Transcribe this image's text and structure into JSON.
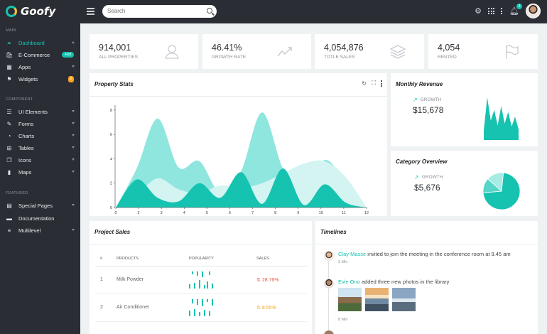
{
  "app": {
    "name": "Goofy"
  },
  "search": {
    "placeholder": "Search"
  },
  "header": {
    "notification_count": "3"
  },
  "sidebar": {
    "sections": [
      {
        "title": "MAIN",
        "items": [
          {
            "label": "Dashboard",
            "icon": "dashboard-icon",
            "active": true
          },
          {
            "label": "E-Commerce",
            "icon": "shop-icon",
            "badge": "Hot"
          },
          {
            "label": "Apps",
            "icon": "apps-grid-icon"
          },
          {
            "label": "Widgets",
            "icon": "flag-icon",
            "badge": "2"
          }
        ]
      },
      {
        "title": "COMPONENT",
        "items": [
          {
            "label": "UI Elements",
            "icon": "list-icon"
          },
          {
            "label": "Forms",
            "icon": "pencil-icon"
          },
          {
            "label": "Charts",
            "icon": "pie-icon"
          },
          {
            "label": "Tables",
            "icon": "table-icon"
          },
          {
            "label": "Icons",
            "icon": "copy-icon"
          },
          {
            "label": "Maps",
            "icon": "map-icon"
          }
        ]
      },
      {
        "title": "FEATURED",
        "items": [
          {
            "label": "Special Pages",
            "icon": "pages-icon"
          },
          {
            "label": "Documentation",
            "icon": "doc-icon"
          },
          {
            "label": "Multilevel",
            "icon": "multilevel-icon"
          }
        ]
      }
    ]
  },
  "stats": [
    {
      "value": "914,001",
      "label": "ALL PROPERTIES",
      "icon": "user-icon"
    },
    {
      "value": "46.41%",
      "label": "GROWTH RATE",
      "icon": "trend-icon"
    },
    {
      "value": "4,054,876",
      "label": "TOTLE SALES",
      "icon": "layers-icon"
    },
    {
      "value": "4,054",
      "label": "RENTED",
      "icon": "flag-icon"
    }
  ],
  "property_stats": {
    "title": "Property Stats"
  },
  "monthly_revenue": {
    "title": "Monthly Revenue",
    "growth_label": "GROWTH",
    "value": "$15,678",
    "sparkline": [
      20,
      88,
      40,
      62,
      30,
      70,
      34,
      58,
      28,
      48,
      22
    ]
  },
  "category_overview": {
    "title": "Category Overview",
    "growth_label": "GROWTH",
    "value": "$5,676",
    "pie": [
      72,
      13,
      15
    ]
  },
  "project_sales": {
    "title": "Project Sales",
    "columns": [
      "#",
      "PRODUCTS",
      "POPULARITY",
      "SALES"
    ],
    "rows": [
      {
        "num": "1",
        "product": "Milk Powder",
        "sales": "28.76%",
        "trend": "up",
        "bars": [
          6,
          -4,
          8,
          -6,
          12,
          -8,
          5,
          10,
          -5,
          7
        ]
      },
      {
        "num": "2",
        "product": "Air Conditioner",
        "sales": "8.55%",
        "trend": "mid",
        "bars": [
          8,
          -6,
          10,
          -8,
          6,
          -10,
          9,
          -4,
          7,
          -9
        ]
      }
    ]
  },
  "timelines": {
    "title": "Timelines",
    "items": [
      {
        "name": "Clay Masse",
        "text": " invited to join the meeting in the conference room at 9.45 am",
        "time": "3 Min"
      },
      {
        "name": "Evie Ono",
        "text": " added three new photos in the library",
        "time": "8 Min"
      }
    ]
  },
  "chart_data": {
    "type": "area",
    "x": [
      0,
      1,
      2,
      3,
      4,
      5,
      6,
      7,
      8,
      9,
      10,
      11,
      12
    ],
    "xticks": [
      "0",
      "2",
      "3",
      "4",
      "5",
      "6",
      "7",
      "8",
      "9",
      "10",
      "11",
      "12"
    ],
    "yticks": [
      "0",
      "2",
      "4",
      "6",
      "8"
    ],
    "ylim": [
      0,
      8.4
    ],
    "colors": [
      "#8ee6df",
      "#d3f4f1",
      "#15c3b0"
    ],
    "series": [
      {
        "values": [
          0,
          3.2,
          7.3,
          3.3,
          3.8,
          1.2,
          3.0,
          7.8,
          3.2,
          1.5,
          3.9,
          2.1,
          0
        ]
      },
      {
        "values": [
          0,
          1.0,
          2.4,
          1.5,
          1.2,
          1.8,
          1.6,
          2.0,
          2.8,
          3.6,
          3.8,
          2.5,
          0
        ]
      },
      {
        "values": [
          0,
          2.3,
          0.8,
          0.5,
          2.0,
          0.8,
          2.9,
          0.3,
          3.2,
          0.2,
          1.9,
          0.4,
          0
        ]
      }
    ]
  }
}
